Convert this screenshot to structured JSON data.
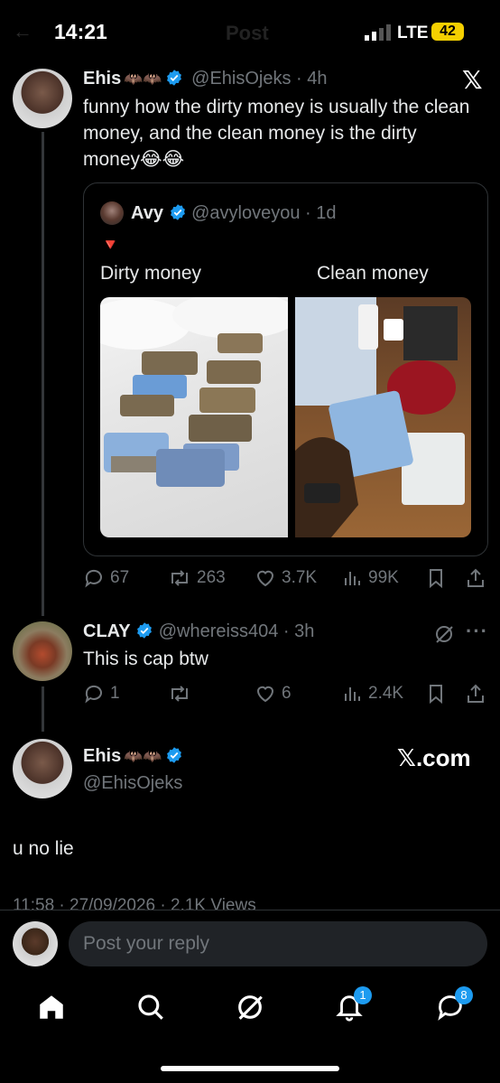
{
  "status_bar": {
    "time": "14:21",
    "network": "LTE",
    "battery": "42"
  },
  "header": {
    "title": "Post"
  },
  "main_post": {
    "name": "Ehis",
    "name_emoji": "🦇🦇",
    "handle": "@EhisOjeks",
    "time": "4h",
    "text": "funny how the dirty money is usually the clean money, and the clean money is the dirty money😂😂",
    "quote": {
      "name": "Avy",
      "handle": "@avyloveyou",
      "time": "1d",
      "marker": "🔻",
      "label_left": "Dirty money",
      "label_right": "Clean money"
    },
    "actions": {
      "replies": "67",
      "reposts": "263",
      "likes": "3.7K",
      "views": "99K"
    }
  },
  "reply": {
    "name": "CLAY",
    "handle": "@whereiss404",
    "time": "3h",
    "text": "This is cap btw",
    "actions": {
      "replies": "1",
      "reposts": "",
      "likes": "6",
      "views": "2.4K"
    }
  },
  "focus_post": {
    "name": "Ehis",
    "name_emoji": "🦇🦇",
    "handle": "@EhisOjeks",
    "brand": "𝕏.com",
    "text": "u no lie",
    "meta": "11:58 · 27/09/2026 · 2.1K Views"
  },
  "composer": {
    "placeholder": "Post your reply"
  },
  "bottom_nav": {
    "notifications_badge": "1",
    "messages_badge": "8"
  },
  "colors": {
    "accent": "#1d9bf0",
    "background": "#000000",
    "muted": "#71767b"
  }
}
